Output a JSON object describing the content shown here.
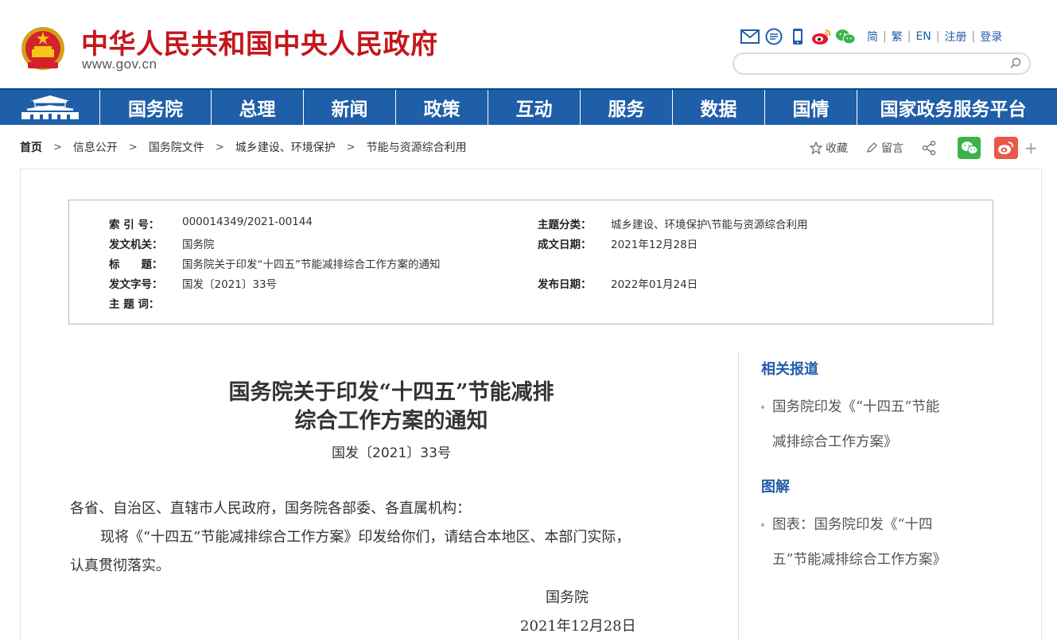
{
  "header": {
    "site_title": "中华人民共和国中央人民政府",
    "site_url": "www.gov.cn",
    "tools": [
      "mail-icon",
      "message-icon",
      "mobile-icon",
      "weibo-icon",
      "wechat-icon"
    ],
    "lang_links": [
      "简",
      "繁",
      "EN",
      "注册",
      "登录"
    ],
    "search_placeholder": ""
  },
  "nav": {
    "items": [
      "国务院",
      "总理",
      "新闻",
      "政策",
      "互动",
      "服务",
      "数据",
      "国情",
      "国家政务服务平台"
    ]
  },
  "breadcrumb": {
    "items": [
      "首页",
      "信息公开",
      "国务院文件",
      "城乡建设、环境保护",
      "节能与资源综合利用"
    ]
  },
  "share": {
    "favorite": "收藏",
    "comment": "留言",
    "plus": "+"
  },
  "meta": {
    "index_no_label": "索 引 号：",
    "index_no": "000014349/2021-00144",
    "topic_label": "主题分类：",
    "topic": "城乡建设、环境保护\\节能与资源综合利用",
    "issuer_label": "发文机关：",
    "issuer": "国务院",
    "written_date_label": "成文日期：",
    "written_date": "2021年12月28日",
    "title_label": "标　　题：",
    "title": "国务院关于印发“十四五”节能减排综合工作方案的通知",
    "doc_no_label": "发文字号：",
    "doc_no": "国发〔2021〕33号",
    "publish_date_label": "发布日期：",
    "publish_date": "2022年01月24日",
    "keywords_label": "主 题 词：",
    "keywords": ""
  },
  "article": {
    "title_line1": "国务院关于印发“十四五”节能减排",
    "title_line2": "综合工作方案的通知",
    "doc_no": "国发〔2021〕33号",
    "salutation": "各省、自治区、直辖市人民政府，国务院各部委、各直属机构：",
    "body_line1": "现将《“十四五”节能减排综合工作方案》印发给你们，请结合本地区、本部门实际，",
    "body_line2": "认真贯彻落实。",
    "signer": "国务院",
    "date": "2021年12月28日"
  },
  "sidebar": {
    "related_heading": "相关报道",
    "related_line1": "国务院印发《“十四五”节能",
    "related_line2": "减排综合工作方案》",
    "graphic_heading": "图解",
    "graphic_line1": "图表：国务院印发《“十四",
    "graphic_line2": "五”节能减排综合工作方案》"
  },
  "colors": {
    "brand_red": "#c4161c",
    "nav_blue": "#1f5ea8",
    "link_blue": "#1f5ea8",
    "wechat_green": "#3bb34a",
    "weibo_red": "#e8584b"
  }
}
